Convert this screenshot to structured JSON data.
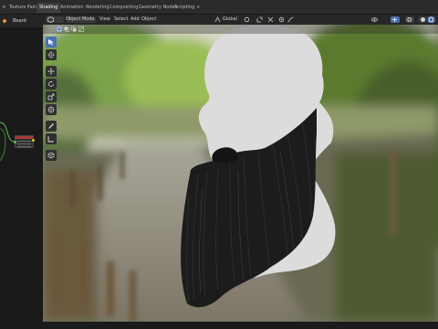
{
  "topbar": {
    "tabs": [
      "e",
      "Texture Paint",
      "Shading",
      "Animation",
      "Rendering",
      "Compositing",
      "Geometry Nodes",
      "Scripting",
      "+"
    ],
    "active_tab": "Shading"
  },
  "left_panel": {
    "object_name": "Beard"
  },
  "viewport_header": {
    "mode": "Object Mode",
    "menus": [
      "View",
      "Select",
      "Add",
      "Object"
    ],
    "transform_orientation": "Global"
  },
  "toolbar": {
    "tools": [
      "select-box",
      "cursor",
      "move",
      "rotate",
      "scale",
      "transform",
      "annotate",
      "measure",
      "add-cube"
    ],
    "active": "select-box"
  },
  "colors": {
    "accent": "#4772b3",
    "header_bg": "#272727",
    "panel_bg": "#1a1a1a",
    "bust_fill": "#dcdcdc",
    "beard_dark": "#1c1c1c"
  },
  "scene": {
    "background": "blurred park path with wooden posts",
    "objects": [
      "bust",
      "beard"
    ]
  }
}
